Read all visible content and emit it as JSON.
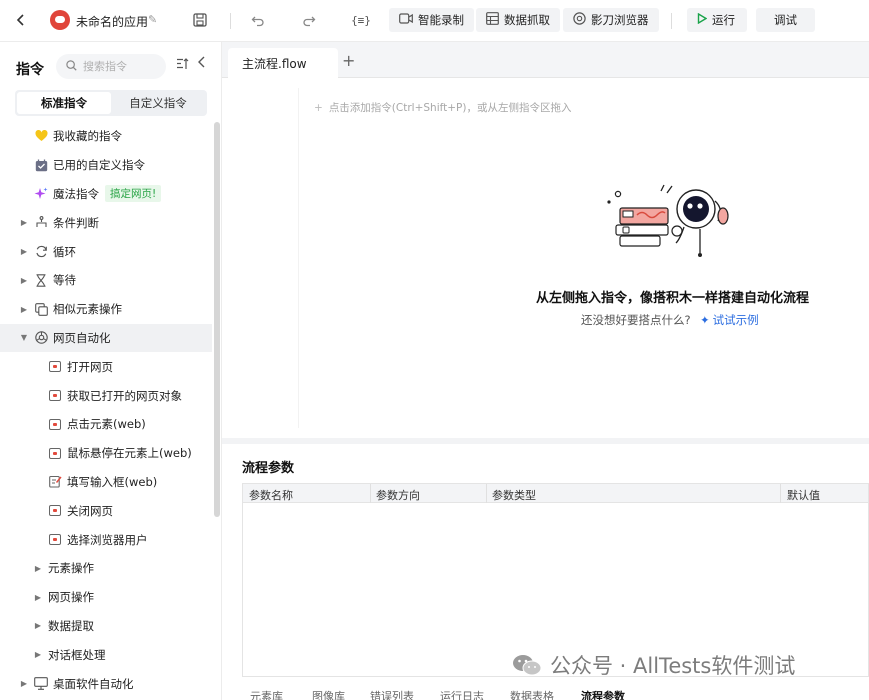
{
  "toolbar": {
    "app_name": "未命名的应用",
    "buttons": {
      "smart_record": "智能录制",
      "data_capture": "数据抓取",
      "browser": "影刀浏览器",
      "run": "运行",
      "debug": "调试"
    }
  },
  "sidebar": {
    "title": "指令",
    "search_placeholder": "搜索指令",
    "tabs": [
      "标准指令",
      "自定义指令"
    ],
    "items": [
      {
        "label": "我收藏的指令",
        "icon": "heart-icon"
      },
      {
        "label": "已用的自定义指令",
        "icon": "calendar-check-icon"
      },
      {
        "label": "魔法指令",
        "icon": "sparkle-icon",
        "badge": "搞定网页!"
      },
      {
        "label": "条件判断",
        "icon": "branch-icon"
      },
      {
        "label": "循环",
        "icon": "loop-icon"
      },
      {
        "label": "等待",
        "icon": "hourglass-icon"
      },
      {
        "label": "相似元素操作",
        "icon": "copy-icon"
      },
      {
        "label": "网页自动化",
        "icon": "globe-icon"
      },
      {
        "label": "打开网页",
        "icon": "web-page-icon"
      },
      {
        "label": "获取已打开的网页对象",
        "icon": "web-page-icon"
      },
      {
        "label": "点击元素(web)",
        "icon": "web-click-icon"
      },
      {
        "label": "鼠标悬停在元素上(web)",
        "icon": "web-hover-icon"
      },
      {
        "label": "填写输入框(web)",
        "icon": "edit-field-icon"
      },
      {
        "label": "关闭网页",
        "icon": "web-close-icon"
      },
      {
        "label": "选择浏览器用户",
        "icon": "web-user-icon"
      },
      {
        "label": "元素操作"
      },
      {
        "label": "网页操作"
      },
      {
        "label": "数据提取"
      },
      {
        "label": "对话框处理"
      },
      {
        "label": "桌面软件自动化",
        "icon": "monitor-icon"
      }
    ]
  },
  "tabs": {
    "main_flow": "主流程.flow"
  },
  "canvas": {
    "add_hint": "点击添加指令(Ctrl+Shift+P)，或从左侧指令区拖入",
    "empty_title": "从左侧拖入指令，像搭积木一样搭建自动化流程",
    "empty_sub": "还没想好要搭点什么?",
    "try_link": "试试示例"
  },
  "params": {
    "title": "流程参数",
    "columns": [
      "参数名称",
      "参数方向",
      "参数类型",
      "默认值"
    ],
    "bottom_tabs": [
      "元素库",
      "图像库",
      "错误列表",
      "运行日志",
      "数据表格",
      "流程参数"
    ]
  },
  "watermark": {
    "text": "公众号 · AllTests软件测试"
  },
  "colors": {
    "accent": "#2b6de0",
    "run_green": "#1aa34a",
    "badge_green": "#27a344",
    "heart": "#f5c518",
    "logo_red": "#e0453a"
  }
}
